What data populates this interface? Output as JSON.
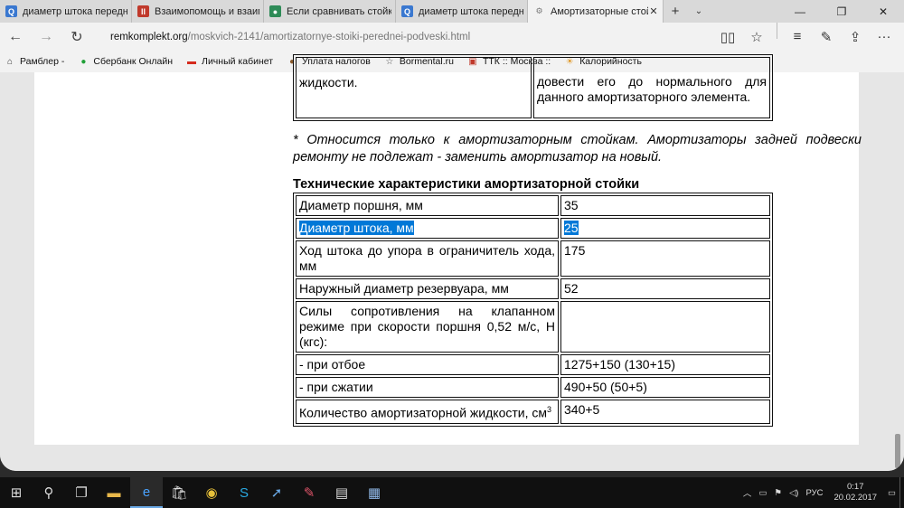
{
  "browser": {
    "tabs": [
      {
        "label": "диаметр штока передней с",
        "icon": "search-icon",
        "color": "#3a78d0",
        "glyph": "Q",
        "active": false
      },
      {
        "label": "Взаимопомощь и взаимов",
        "icon": "forum-icon",
        "color": "#c0392b",
        "glyph": "ll",
        "active": false
      },
      {
        "label": "Если сравнивать стойки, д",
        "icon": "site-icon",
        "color": "#2e8b57",
        "glyph": "●",
        "active": false
      },
      {
        "label": "диаметр штока передней с",
        "icon": "search-icon",
        "color": "#3a78d0",
        "glyph": "Q",
        "active": false
      },
      {
        "label": "Амортизаторные стойки",
        "icon": "gear-icon",
        "color": "#777777",
        "glyph": "⚙",
        "active": true
      }
    ],
    "url_host": "remkomplekt.org",
    "url_path": "/moskvich-2141/amortizatornye-stoiki-perednei-podveski.html",
    "favorites": [
      {
        "label": "Рамблер -",
        "icon": "home-icon",
        "glyph": "⌂",
        "color": "#333333"
      },
      {
        "label": "Сбербанк Онлайн",
        "icon": "sberbank-icon",
        "glyph": "●",
        "color": "#21a038"
      },
      {
        "label": "Личный кабинет",
        "icon": "flag-icon",
        "glyph": "▬",
        "color": "#d52b1e"
      },
      {
        "label": "Уплата налогов",
        "icon": "tax-icon",
        "glyph": "●",
        "color": "#8a5a2b"
      },
      {
        "label": "Bormental.ru",
        "icon": "star-icon",
        "glyph": "☆",
        "color": "#555555"
      },
      {
        "label": "ТТК :: Москва ::",
        "icon": "ttk-icon",
        "glyph": "▣",
        "color": "#c0392b"
      },
      {
        "label": "Калорийность",
        "icon": "calories-icon",
        "glyph": "☀",
        "color": "#e09a2b"
      }
    ]
  },
  "page": {
    "top_table": {
      "left": "жидкости.",
      "right": "довести его до нормального для данного амортизаторного элемента."
    },
    "note": "* Относится только к амортизаторным стойкам. Амортизаторы задней подвески ремонту не подлежат - заменить амортизатор на новый.",
    "heading": "Технические характеристики амортизаторной стойки",
    "specs": [
      {
        "label": "Диаметр поршня, мм",
        "value": "35",
        "selected": false
      },
      {
        "label": "Диаметр штока, мм",
        "value": "25",
        "selected": true
      },
      {
        "label": "Ход штока до упора в ограничитель хода, мм",
        "value": "175",
        "selected": false
      },
      {
        "label": "Наружный диаметр резервуара, мм",
        "value": "52",
        "selected": false
      },
      {
        "label": "Силы сопротивления на клапанном режиме при скорости поршня 0,52 м/с, Н (кгс):",
        "value": "",
        "selected": false
      },
      {
        "label": "- при отбое",
        "value": "1275+150 (130+15)",
        "selected": false
      },
      {
        "label": "- при сжатии",
        "value": "490+50 (50+5)",
        "selected": false
      },
      {
        "label": "Количество амортизаторной жидкости, см",
        "label_sup": "3",
        "value": "340+5",
        "selected": false
      }
    ]
  },
  "taskbar": {
    "language": "РУС",
    "time": "0:17",
    "date": "20.02.2017"
  }
}
